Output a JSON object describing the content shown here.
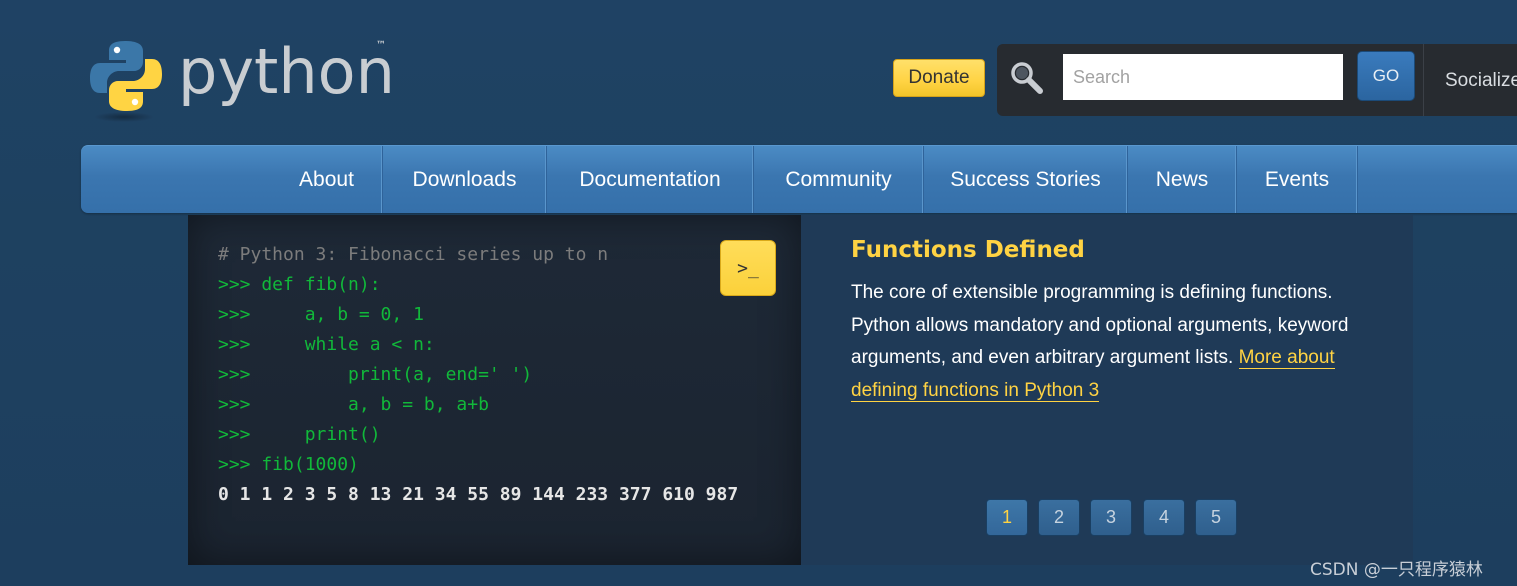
{
  "header": {
    "logo_text": "python",
    "logo_tm": "™",
    "donate_label": "Donate",
    "search_placeholder": "Search",
    "go_label": "GO",
    "socialize_label": "Socialize"
  },
  "nav": {
    "items": [
      {
        "label": "About"
      },
      {
        "label": "Downloads"
      },
      {
        "label": "Documentation"
      },
      {
        "label": "Community"
      },
      {
        "label": "Success Stories"
      },
      {
        "label": "News"
      },
      {
        "label": "Events"
      }
    ]
  },
  "hero": {
    "code_lines": [
      {
        "type": "comment",
        "text": "# Python 3: Fibonacci series up to n"
      },
      {
        "type": "prompt",
        "text": ">>> def fib(n):"
      },
      {
        "type": "prompt",
        "text": ">>>     a, b = 0, 1"
      },
      {
        "type": "prompt",
        "text": ">>>     while a < n:"
      },
      {
        "type": "prompt",
        "text": ">>>         print(a, end=' ')"
      },
      {
        "type": "prompt",
        "text": ">>>         a, b = b, a+b"
      },
      {
        "type": "prompt",
        "text": ">>>     print()"
      },
      {
        "type": "prompt",
        "text": ">>> fib(1000)"
      },
      {
        "type": "output",
        "text": "0 1 1 2 3 5 8 13 21 34 55 89 144 233 377 610 987"
      }
    ],
    "shell_label": ">_",
    "title": "Functions Defined",
    "body_text": "The core of extensible programming is defining functions. Python allows mandatory and optional arguments, keyword arguments, and even arbitrary argument lists.",
    "link_text": "More about defining functions in Python 3",
    "pages": [
      "1",
      "2",
      "3",
      "4",
      "5"
    ],
    "active_page": "1"
  },
  "watermark": "CSDN @一只程序猿林",
  "colors": {
    "background": "#1e4160",
    "nav": "#3b76b0",
    "accent_yellow": "#ffd343",
    "code_green": "#11b83a",
    "code_panel": "#1e2937"
  }
}
